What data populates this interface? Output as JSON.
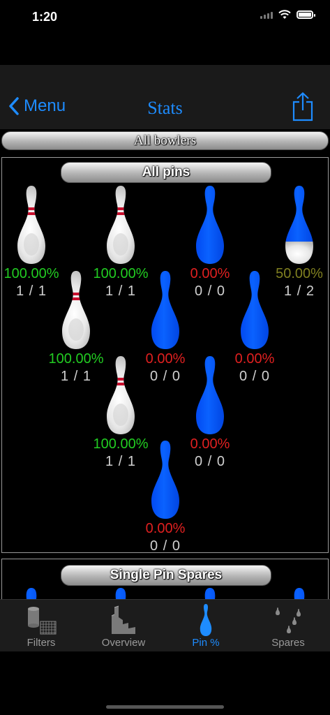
{
  "status_bar": {
    "time": "1:20"
  },
  "nav": {
    "back_label": "Menu",
    "title": "Stats"
  },
  "bowler_filter": "All bowlers",
  "pins_section": {
    "title": "All pins",
    "pins": [
      {
        "pin": 7,
        "pct": "100.00%",
        "count": "1 / 1",
        "state": "standing",
        "pct_color": "#22cc22"
      },
      {
        "pin": 8,
        "pct": "100.00%",
        "count": "1 / 1",
        "state": "standing",
        "pct_color": "#22cc22"
      },
      {
        "pin": 9,
        "pct": "0.00%",
        "count": "0 / 0",
        "state": "blue",
        "pct_color": "#e02020"
      },
      {
        "pin": 10,
        "pct": "50.00%",
        "count": "1 / 2",
        "state": "half",
        "pct_color": "#808020"
      },
      {
        "pin": 4,
        "pct": "100.00%",
        "count": "1 / 1",
        "state": "standing",
        "pct_color": "#22cc22"
      },
      {
        "pin": 5,
        "pct": "0.00%",
        "count": "0 / 0",
        "state": "blue",
        "pct_color": "#e02020"
      },
      {
        "pin": 6,
        "pct": "0.00%",
        "count": "0 / 0",
        "state": "blue",
        "pct_color": "#e02020"
      },
      {
        "pin": 2,
        "pct": "100.00%",
        "count": "1 / 1",
        "state": "standing",
        "pct_color": "#22cc22"
      },
      {
        "pin": 3,
        "pct": "0.00%",
        "count": "0 / 0",
        "state": "blue",
        "pct_color": "#e02020"
      },
      {
        "pin": 1,
        "pct": "0.00%",
        "count": "0 / 0",
        "state": "blue",
        "pct_color": "#e02020"
      }
    ]
  },
  "spares_section": {
    "title": "Single Pin Spares"
  },
  "tabs": [
    {
      "label": "Filters",
      "icon": "filters-icon",
      "active": false
    },
    {
      "label": "Overview",
      "icon": "overview-icon",
      "active": false
    },
    {
      "label": "Pin %",
      "icon": "pin-icon",
      "active": true
    },
    {
      "label": "Spares",
      "icon": "spares-icon",
      "active": false
    }
  ],
  "colors": {
    "accent": "#1e8cff",
    "pin_blue": "#0055ff",
    "good": "#22cc22",
    "bad": "#e02020",
    "mid": "#808020"
  }
}
